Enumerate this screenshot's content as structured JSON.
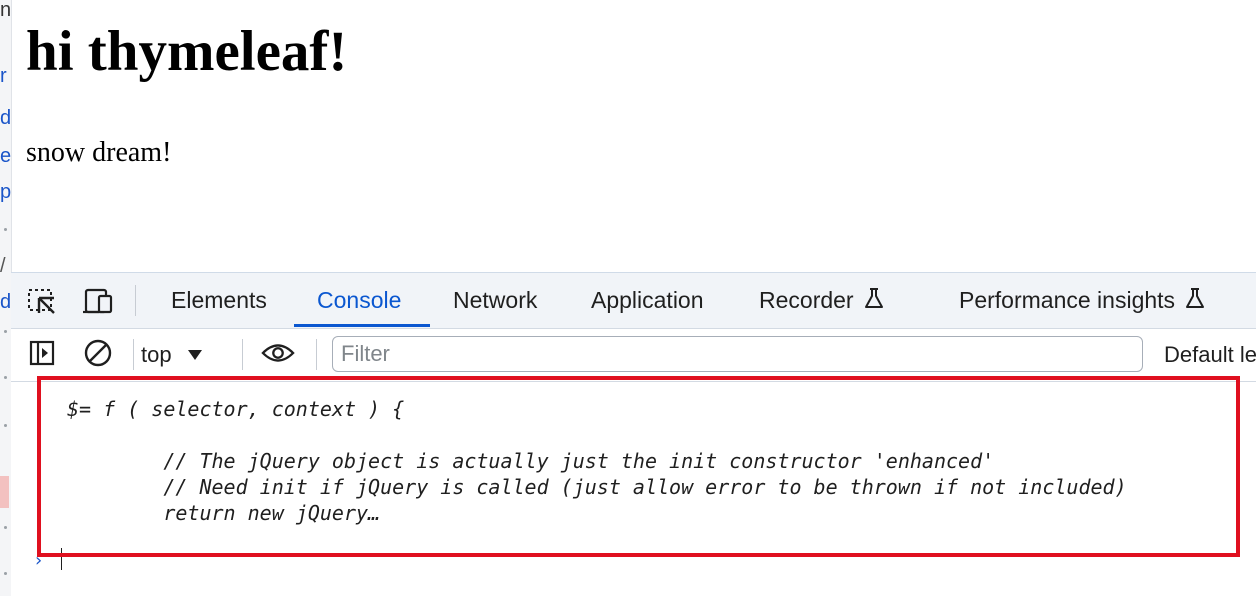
{
  "page": {
    "heading": "hi thymeleaf!",
    "text": "snow dream!"
  },
  "left_edge": {
    "chars": [
      "n",
      "r",
      "d",
      "e",
      "p",
      "/",
      "d"
    ]
  },
  "devtools": {
    "tabs": [
      {
        "label": "Elements",
        "active": false
      },
      {
        "label": "Console",
        "active": true
      },
      {
        "label": "Network",
        "active": false
      },
      {
        "label": "Application",
        "active": false
      },
      {
        "label": "Recorder",
        "active": false,
        "icon": "flask-icon"
      },
      {
        "label": "Performance insights",
        "active": false,
        "icon": "flask-icon"
      }
    ],
    "toolbar": {
      "context": "top",
      "filter_placeholder": "Filter",
      "levels": "Default le"
    },
    "console": {
      "lines": [
        "$= f ( selector, context ) {",
        "",
        "        // The jQuery object is actually just the init constructor 'enhanced'",
        "        // Need init if jQuery is called (just allow error to be thrown if not included)",
        "        return new jQuery…"
      ],
      "prompt": "›"
    },
    "colors": {
      "accent": "#0b57d0",
      "highlight": "#e0101f"
    }
  }
}
